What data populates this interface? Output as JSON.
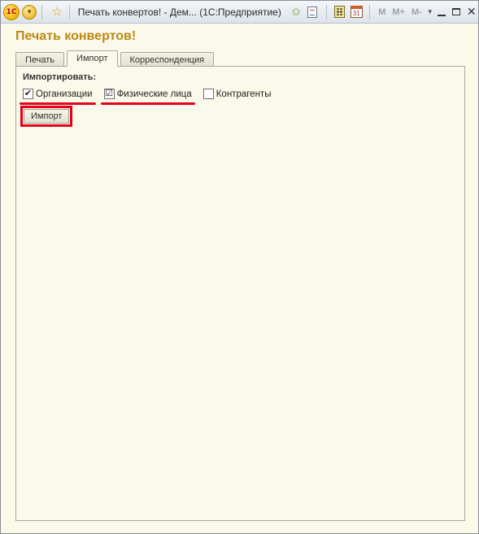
{
  "window": {
    "title": "Печать конвертов! - Дем...  (1С:Предприятие)",
    "logo_text": "1С",
    "memory": [
      "M",
      "M+",
      "M-"
    ]
  },
  "page": {
    "title": "Печать конвертов!"
  },
  "tabs": [
    {
      "label": "Печать",
      "active": false
    },
    {
      "label": "Импорт",
      "active": true
    },
    {
      "label": "Корреспонденция",
      "active": false
    }
  ],
  "import_panel": {
    "heading": "Импортировать:",
    "checkboxes": [
      {
        "label": "Организации",
        "checked": true
      },
      {
        "label": "Физические лица",
        "checked": true
      },
      {
        "label": "Контрагенты",
        "checked": false
      }
    ],
    "button_label": "Импорт"
  },
  "colors": {
    "title_color": "#b98a16",
    "highlight_red": "#e2001a",
    "form_background": "#fbf9e9"
  }
}
